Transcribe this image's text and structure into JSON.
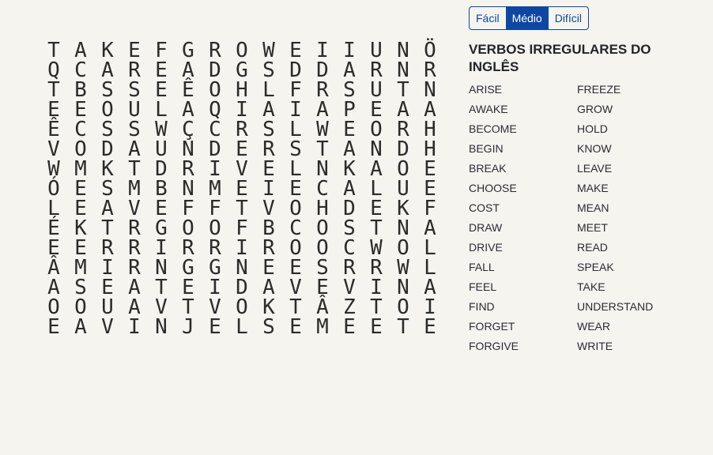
{
  "difficulty": {
    "options": [
      "Fácil",
      "Médio",
      "Difícil"
    ],
    "selected": "Médio",
    "accent_color": "#0d47a1"
  },
  "word_list": {
    "title": "VERBOS IRREGULARES DO INGLÊS",
    "words": [
      "ARISE",
      "AWAKE",
      "BECOME",
      "BEGIN",
      "BREAK",
      "CHOOSE",
      "COST",
      "DRAW",
      "DRIVE",
      "FALL",
      "FEEL",
      "FIND",
      "FORGET",
      "FORGIVE",
      "FREEZE",
      "GROW",
      "HOLD",
      "KNOW",
      "LEAVE",
      "MAKE",
      "MEAN",
      "MEET",
      "READ",
      "SPEAK",
      "TAKE",
      "UNDERSTAND",
      "WEAR",
      "WRITE"
    ]
  },
  "grid": [
    [
      "T",
      "A",
      "K",
      "E",
      "F",
      "G",
      "R",
      "O",
      "W",
      "E",
      "I",
      "I",
      "U",
      "N",
      "Ö"
    ],
    [
      "Q",
      "C",
      "A",
      "R",
      "E",
      "A",
      "D",
      "G",
      "S",
      "D",
      "D",
      "A",
      "R",
      "N",
      "R"
    ],
    [
      "T",
      "B",
      "S",
      "S",
      "E",
      "Ê",
      "O",
      "H",
      "L",
      "F",
      "R",
      "S",
      "U",
      "T",
      "N"
    ],
    [
      "E",
      "E",
      "O",
      "U",
      "L",
      "A",
      "Q",
      "I",
      "A",
      "I",
      "A",
      "P",
      "E",
      "A",
      "A"
    ],
    [
      "Ê",
      "C",
      "S",
      "S",
      "W",
      "Ç",
      "C",
      "R",
      "S",
      "L",
      "W",
      "E",
      "O",
      "R",
      "H"
    ],
    [
      "V",
      "O",
      "D",
      "A",
      "U",
      "N",
      "D",
      "E",
      "R",
      "S",
      "T",
      "A",
      "N",
      "D",
      "H"
    ],
    [
      "W",
      "M",
      "K",
      "T",
      "D",
      "R",
      "I",
      "V",
      "E",
      "L",
      "N",
      "K",
      "A",
      "O",
      "E"
    ],
    [
      "Ó",
      "E",
      "S",
      "M",
      "B",
      "N",
      "M",
      "E",
      "I",
      "E",
      "C",
      "A",
      "L",
      "U",
      "E"
    ],
    [
      "L",
      "E",
      "A",
      "V",
      "E",
      "F",
      "F",
      "T",
      "V",
      "O",
      "H",
      "D",
      "E",
      "K",
      "F"
    ],
    [
      "É",
      "K",
      "T",
      "R",
      "G",
      "O",
      "O",
      "F",
      "B",
      "C",
      "O",
      "S",
      "T",
      "N",
      "A"
    ],
    [
      "E",
      "E",
      "R",
      "R",
      "I",
      "R",
      "R",
      "I",
      "R",
      "O",
      "O",
      "C",
      "W",
      "O",
      "L"
    ],
    [
      "Â",
      "M",
      "I",
      "R",
      "N",
      "G",
      "G",
      "N",
      "E",
      "E",
      "S",
      "R",
      "R",
      "W",
      "L"
    ],
    [
      "A",
      "S",
      "E",
      "A",
      "T",
      "E",
      "I",
      "D",
      "A",
      "V",
      "E",
      "V",
      "I",
      "N",
      "A"
    ],
    [
      "O",
      "O",
      "U",
      "A",
      "V",
      "T",
      "V",
      "O",
      "K",
      "T",
      "Â",
      "Z",
      "T",
      "O",
      "I"
    ],
    [
      "E",
      "A",
      "V",
      "I",
      "N",
      "J",
      "E",
      "L",
      "S",
      "E",
      "M",
      "E",
      "E",
      "T",
      "E"
    ]
  ]
}
